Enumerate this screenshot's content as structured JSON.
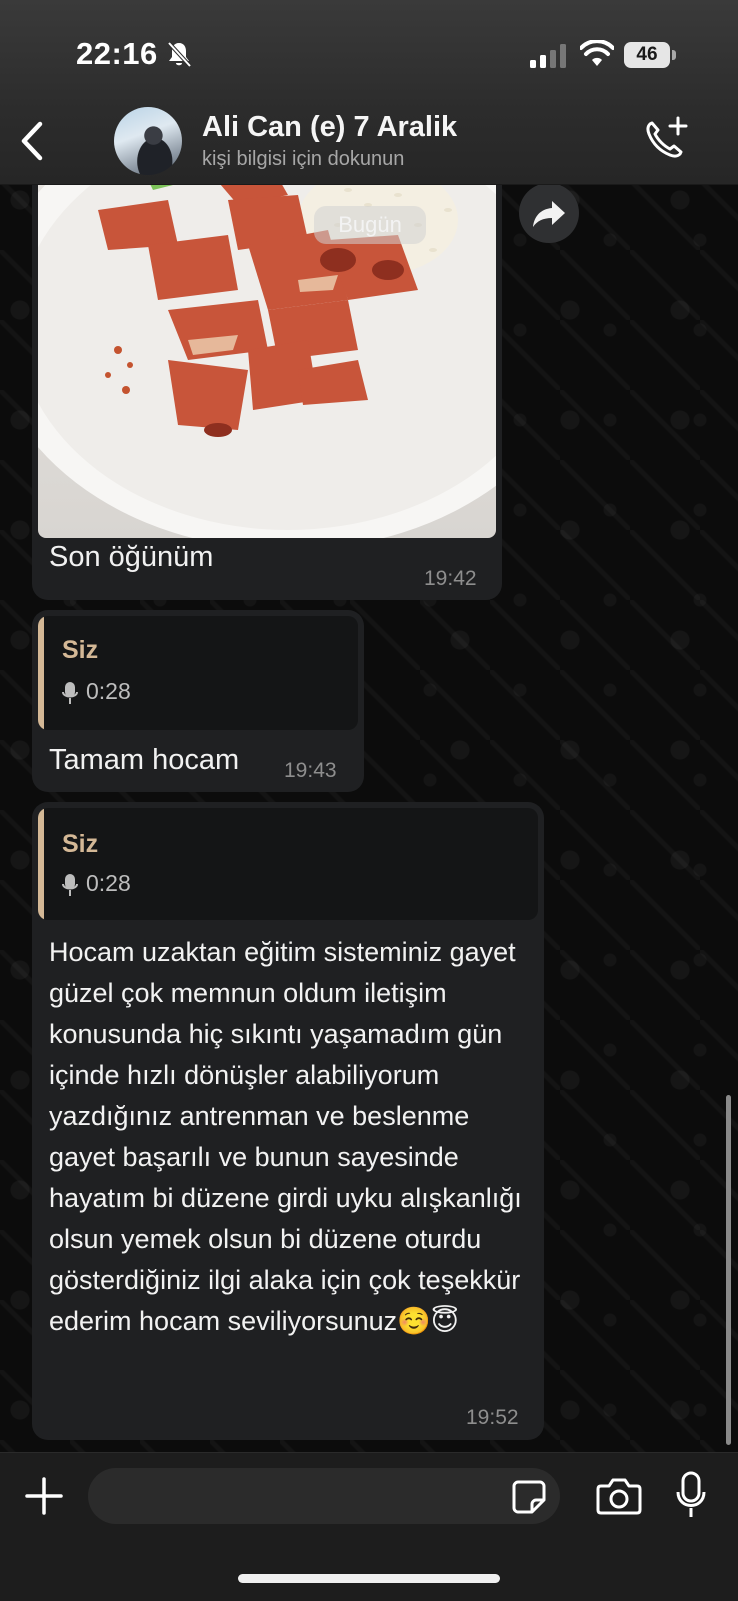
{
  "status_bar": {
    "time": "22:16",
    "battery": "46"
  },
  "header": {
    "contact_name": "Ali Can (e) 7 Aralik",
    "subtitle": "kişi bilgisi için dokunun"
  },
  "date_chip": "Bugün",
  "messages": [
    {
      "type": "image",
      "caption": "Son öğünüm",
      "time": "19:42"
    },
    {
      "type": "reply",
      "quoted_author": "Siz",
      "quoted_audio_duration": "0:28",
      "text": "Tamam hocam",
      "time": "19:43"
    },
    {
      "type": "reply",
      "quoted_author": "Siz",
      "quoted_audio_duration": "0:28",
      "text": "Hocam uzaktan eğitim sisteminiz gayet güzel çok memnun oldum iletişim konusunda hiç sıkıntı yaşamadım gün içinde hızlı dönüşler alabiliyorum yazdığınız antrenman ve beslenme gayet başarılı ve bunun sayesinde hayatım bi düzene girdi uyku alışkanlığı olsun yemek olsun bi düzene oturdu gösterdiğiniz ilgi alaka için çok teşekkür ederim hocam seviliyorsunuz☺️😇",
      "time": "19:52"
    }
  ],
  "composer": {
    "placeholder": ""
  },
  "colors": {
    "quote_accent": "#d4b896",
    "bubble": "#1f2022",
    "header": "#2c2c2c"
  }
}
